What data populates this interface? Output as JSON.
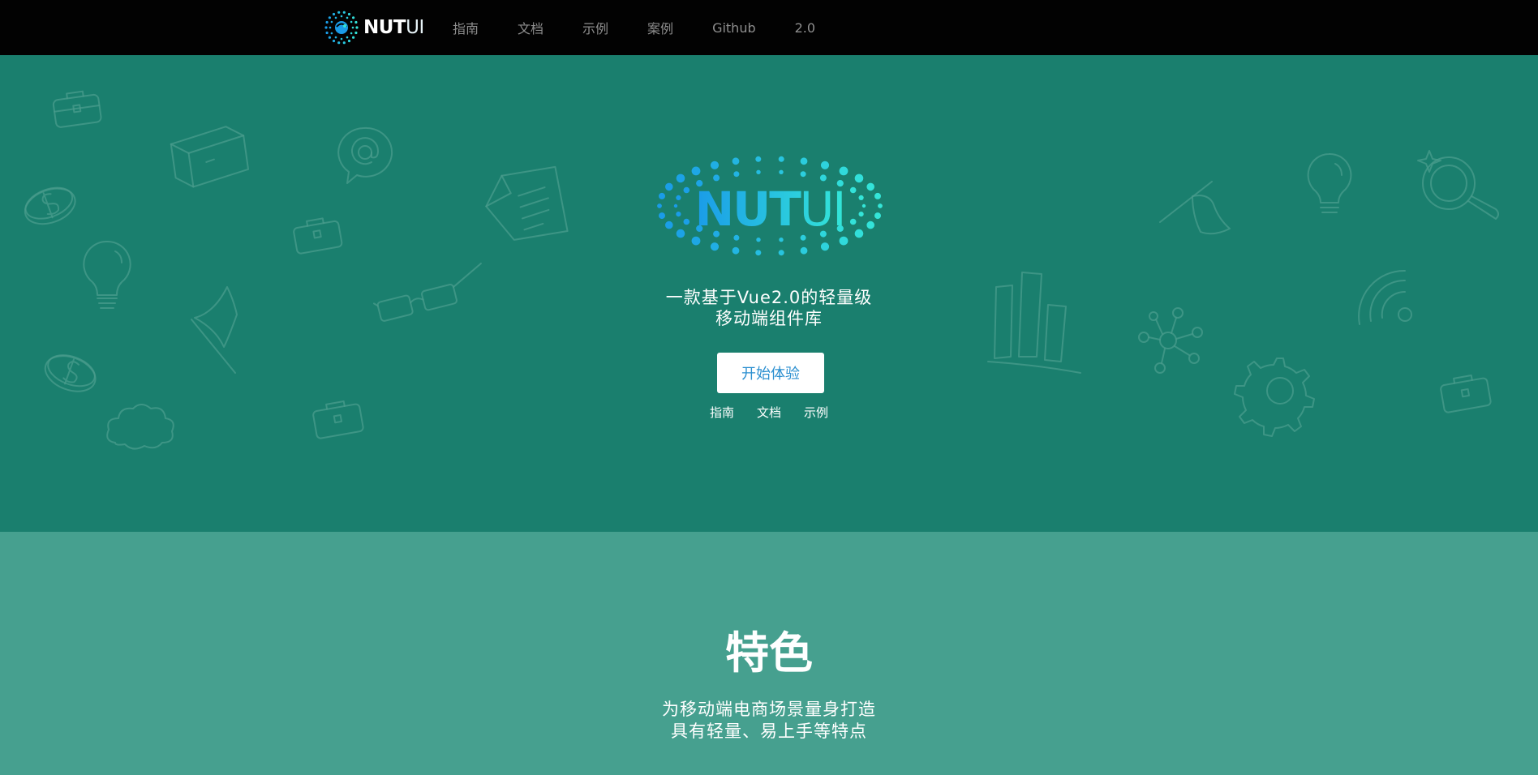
{
  "header": {
    "brand": {
      "bold": "NUT",
      "light": "UI"
    },
    "nav": [
      "指南",
      "文档",
      "示例",
      "案例",
      "Github",
      "2.0"
    ]
  },
  "hero": {
    "logo_text": {
      "bold": "NUT",
      "light": "UI"
    },
    "tagline_line1": "一款基于Vue2.0的轻量级",
    "tagline_line2": "移动端组件库",
    "cta_label": "开始体验",
    "links": [
      "指南",
      "文档",
      "示例"
    ]
  },
  "features": {
    "title": "特色",
    "subtitle_line1": "为移动端电商场景量身打造",
    "subtitle_line2": "具有轻量、易上手等特点"
  },
  "colors": {
    "topbar": "#020202",
    "hero_bg": "#1a7f6e",
    "features_bg": "#46a08f",
    "logo_blue": "#1a9be8",
    "logo_cyan": "#34e6d8"
  },
  "icons": [
    "briefcase-icon",
    "box-icon",
    "at-sign-icon",
    "coin-icon",
    "lightbulb-icon",
    "flag-icon",
    "cloud-icon",
    "document-icon",
    "glasses-icon",
    "bar-chart-icon",
    "network-icon",
    "gear-icon",
    "wifi-icon",
    "magnifier-icon"
  ]
}
